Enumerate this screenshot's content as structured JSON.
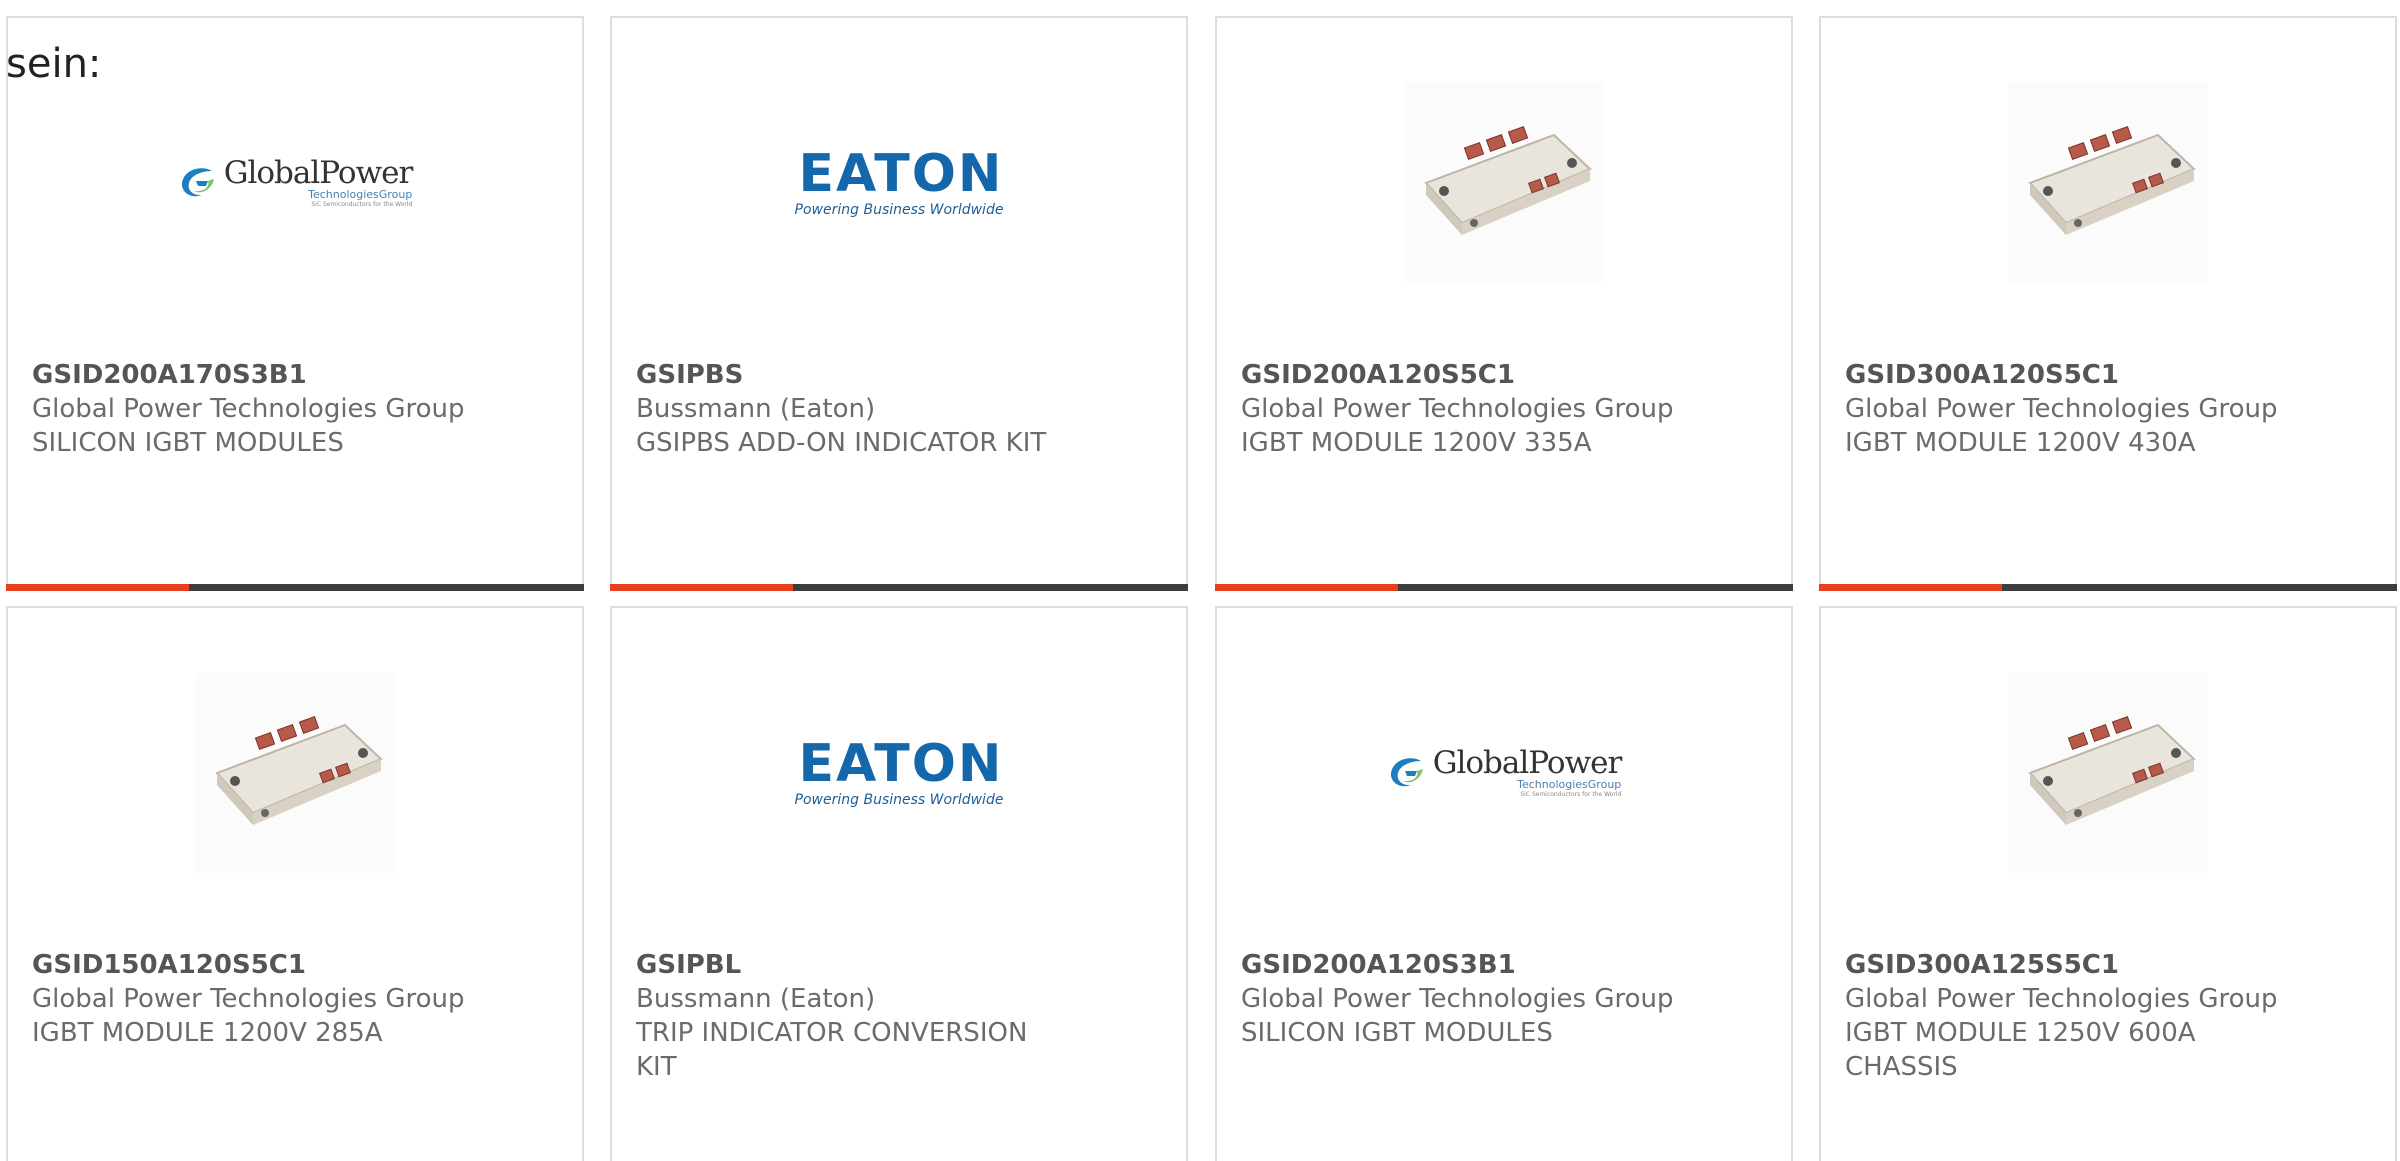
{
  "intro_text": "sein:",
  "logos": {
    "globalpower": {
      "name": "GlobalPower",
      "sub": "TechnologiesGroup",
      "tiny": "SiC Semiconductors for the World"
    },
    "eaton": {
      "name": "EATON",
      "tagline": "Powering Business Worldwide"
    }
  },
  "colors": {
    "bar_dark": "#3d3d3d",
    "bar_accent": "#e8401c",
    "eaton_blue": "#1467ab"
  },
  "products": [
    {
      "part": "GSID200A170S3B1",
      "manufacturer": "Global Power Technologies Group",
      "description": "SILICON IGBT MODULES",
      "image": "globalpower-logo"
    },
    {
      "part": "GSIPBS",
      "manufacturer": "Bussmann (Eaton)",
      "description": "GSIPBS ADD-ON INDICATOR KIT",
      "image": "eaton-logo"
    },
    {
      "part": "GSID200A120S5C1",
      "manufacturer": "Global Power Technologies Group",
      "description": "IGBT MODULE 1200V 335A",
      "image": "igbt-module-photo"
    },
    {
      "part": "GSID300A120S5C1",
      "manufacturer": "Global Power Technologies Group",
      "description": "IGBT MODULE 1200V 430A",
      "image": "igbt-module-photo"
    },
    {
      "part": "GSID150A120S5C1",
      "manufacturer": "Global Power Technologies Group",
      "description": "IGBT MODULE 1200V 285A",
      "image": "igbt-module-photo"
    },
    {
      "part": "GSIPBL",
      "manufacturer": "Bussmann (Eaton)",
      "description": "TRIP INDICATOR CONVERSION KIT",
      "image": "eaton-logo"
    },
    {
      "part": "GSID200A120S3B1",
      "manufacturer": "Global Power Technologies Group",
      "description": "SILICON IGBT MODULES",
      "image": "globalpower-logo"
    },
    {
      "part": "GSID300A125S5C1",
      "manufacturer": "Global Power Technologies Group",
      "description": "IGBT MODULE 1250V 600A CHASSIS",
      "image": "igbt-module-photo"
    }
  ]
}
